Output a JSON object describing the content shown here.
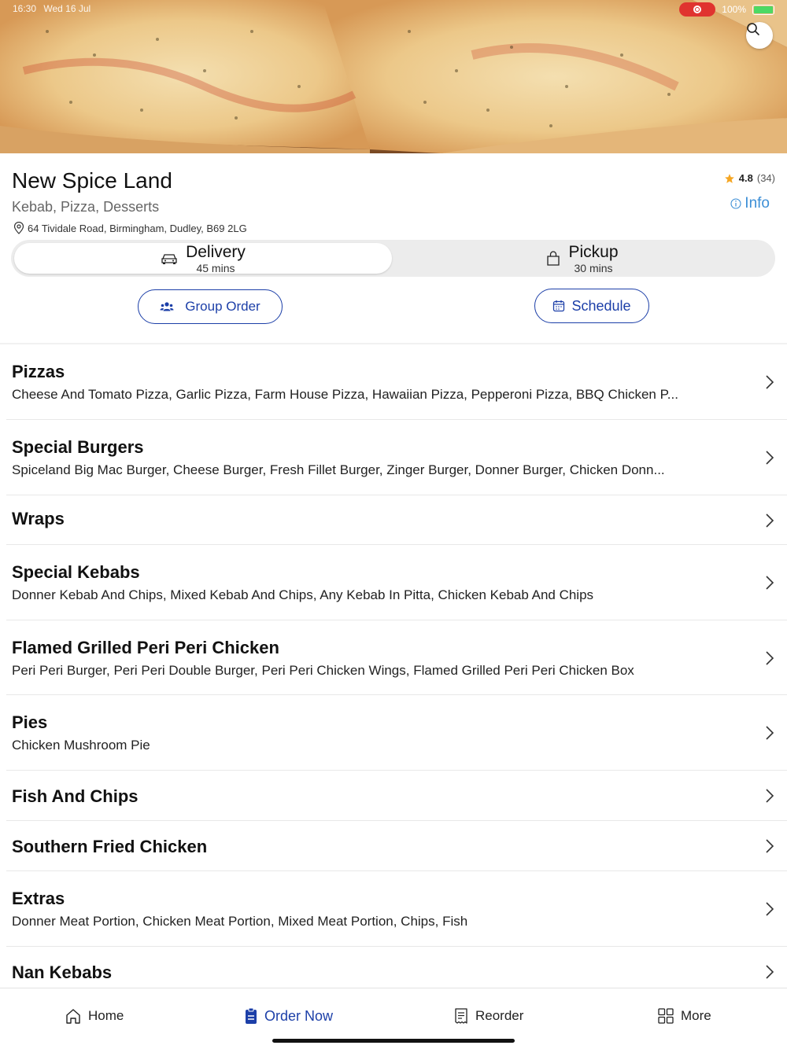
{
  "status_bar": {
    "time": "16:30",
    "date": "Wed 16 Jul",
    "battery": "100%"
  },
  "restaurant": {
    "name": "New Spice Land",
    "cuisine": "Kebab, Pizza, Desserts",
    "address": "64 Tividale Road, Birmingham, Dudley, B69 2LG",
    "rating": "4.8",
    "rating_count": "(34)",
    "info_label": "Info"
  },
  "order_mode": {
    "delivery": {
      "label": "Delivery",
      "time": "45 mins",
      "selected": true
    },
    "pickup": {
      "label": "Pickup",
      "time": "30 mins",
      "selected": false
    }
  },
  "actions": {
    "group_order": "Group Order",
    "schedule": "Schedule"
  },
  "categories": [
    {
      "title": "Pizzas",
      "desc": "Cheese And Tomato Pizza, Garlic Pizza, Farm House Pizza, Hawaiian Pizza, Pepperoni Pizza, BBQ Chicken P..."
    },
    {
      "title": "Special Burgers",
      "desc": "Spiceland Big Mac Burger, Cheese Burger, Fresh Fillet Burger, Zinger Burger, Donner Burger, Chicken Donn..."
    },
    {
      "title": "Wraps",
      "desc": ""
    },
    {
      "title": "Special Kebabs",
      "desc": "Donner Kebab And Chips, Mixed Kebab And Chips, Any Kebab In Pitta, Chicken Kebab And Chips"
    },
    {
      "title": "Flamed Grilled Peri Peri Chicken",
      "desc": "Peri Peri Burger, Peri Peri Double Burger, Peri Peri Chicken Wings, Flamed Grilled Peri Peri Chicken Box"
    },
    {
      "title": "Pies",
      "desc": "Chicken Mushroom Pie"
    },
    {
      "title": "Fish And Chips",
      "desc": ""
    },
    {
      "title": "Southern Fried Chicken",
      "desc": ""
    },
    {
      "title": "Extras",
      "desc": "Donner Meat Portion, Chicken Meat Portion, Mixed Meat Portion, Chips, Fish"
    },
    {
      "title": "Nan Kebabs",
      "desc": ""
    }
  ],
  "bottom_nav": {
    "home": "Home",
    "order_now": "Order Now",
    "reorder": "Reorder",
    "more": "More",
    "active": "order_now"
  },
  "colors": {
    "accent": "#1c3fa8",
    "info": "#3d8fd6",
    "star": "#f5a623",
    "record": "#e0332f"
  }
}
